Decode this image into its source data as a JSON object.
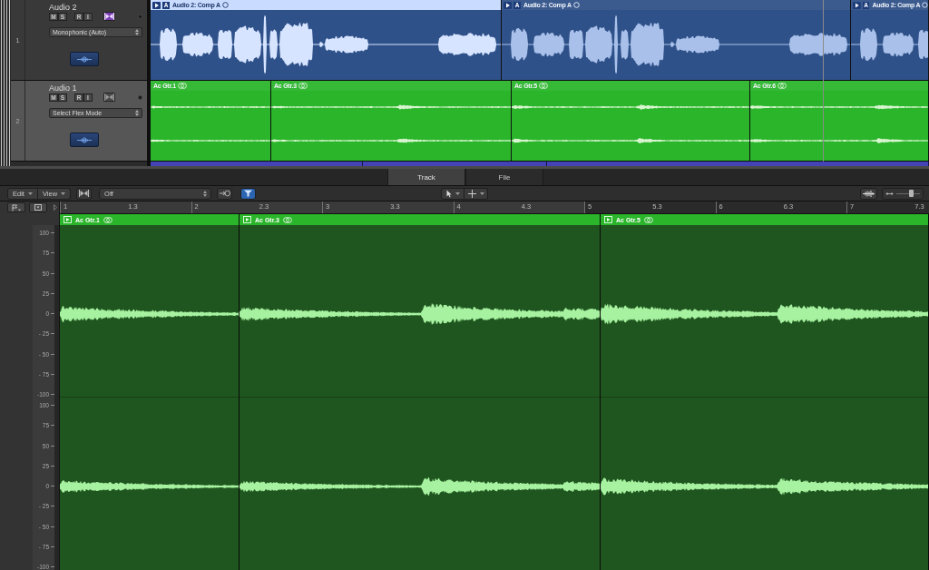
{
  "arrange": {
    "tracks": [
      {
        "number": "1",
        "name": "Audio 2",
        "kind": "comp",
        "selected": false,
        "color": "#2f5189",
        "controls": [
          {
            "label": "M",
            "on": false
          },
          {
            "label": "S",
            "on": false
          },
          {
            "label": "R",
            "on": false
          },
          {
            "label": "I",
            "on": false
          }
        ],
        "flex_on": true,
        "flex_mode": "Monophonic (Auto)",
        "regions": [
          {
            "name": "Audio 2: Comp A",
            "take": "A",
            "selected": true
          },
          {
            "name": "Audio 2: Comp A",
            "take": "A",
            "selected": false
          },
          {
            "name": "Audio 2: Comp A",
            "take": "A",
            "selected": false
          }
        ]
      },
      {
        "number": "2",
        "name": "Audio 1",
        "kind": "audio",
        "selected": true,
        "color": "#2ab52a",
        "controls": [
          {
            "label": "M",
            "on": false
          },
          {
            "label": "S",
            "on": false
          },
          {
            "label": "R",
            "on": false
          },
          {
            "label": "I",
            "on": false
          }
        ],
        "flex_on": false,
        "flex_mode": "Select Flex Mode",
        "regions": [
          {
            "name": "Ac Gtr.1",
            "selected": false
          },
          {
            "name": "Ac Gtr.3",
            "selected": false
          },
          {
            "name": "Ac Gtr.5",
            "selected": false
          },
          {
            "name": "Ac Gtr.6",
            "selected": false
          }
        ]
      }
    ]
  },
  "editor": {
    "tabs": [
      {
        "label": "Track",
        "selected": true
      },
      {
        "label": "File",
        "selected": false
      }
    ],
    "toolbar": {
      "left": [
        {
          "kind": "menu",
          "label": "Edit"
        },
        {
          "kind": "menu",
          "label": "View"
        },
        {
          "kind": "flex-toggle",
          "on": false
        },
        {
          "kind": "dropdown",
          "value": "Off"
        },
        {
          "kind": "catch",
          "on": false
        },
        {
          "kind": "link",
          "on": true
        }
      ],
      "tools": [
        {
          "kind": "pointer"
        },
        {
          "kind": "marquee"
        }
      ],
      "right": [
        {
          "kind": "waveform-zoom"
        },
        {
          "kind": "zoom-slider",
          "level": 0.65
        }
      ]
    },
    "ruler": {
      "marks": [
        "1",
        "1.3",
        "2",
        "2.3",
        "3",
        "3.3",
        "4",
        "4.3",
        "5",
        "5.3",
        "6",
        "6.3",
        "7",
        "7.3"
      ]
    },
    "amplitude_scale": {
      "channels": [
        {
          "ticks": [
            "100",
            "75",
            "50",
            "25",
            "0",
            "- 25",
            "- 50",
            "- 75",
            "-100"
          ]
        },
        {
          "ticks": [
            "100",
            "75",
            "50",
            "25",
            "0",
            "- 25",
            "- 50",
            "- 75",
            "-100"
          ]
        }
      ]
    },
    "regions": [
      {
        "name": "Ac Gtr.1"
      },
      {
        "name": "Ac Gtr.3"
      },
      {
        "name": "Ac Gtr.5"
      }
    ]
  }
}
